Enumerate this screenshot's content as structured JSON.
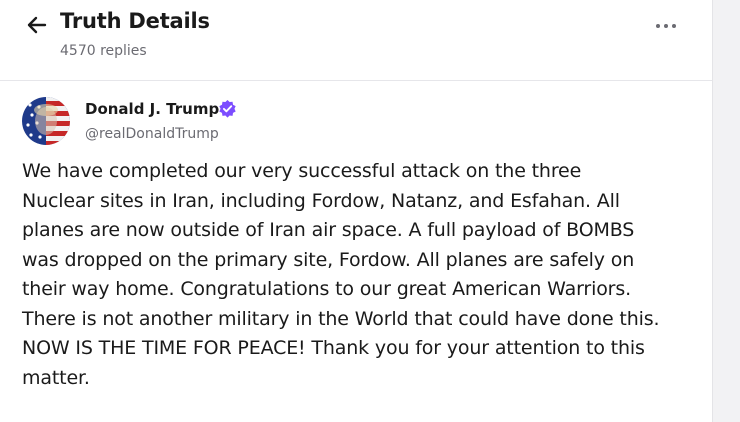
{
  "header": {
    "title": "Truth Details",
    "replies": "4570 replies"
  },
  "author": {
    "display_name": "Donald J. Trump",
    "handle": "@realDonaldTrump",
    "verified": true
  },
  "post": {
    "lines": [
      "We have completed our very successful attack on the three",
      "Nuclear sites in Iran, including Fordow, Natanz, and Esfahan. All",
      "planes are now outside of Iran air space. A full payload of BOMBS",
      "was dropped on the primary site, Fordow. All planes are safely on",
      "their way home. Congratulations to our great American Warriors.",
      "There is not another military in the World that could have done this.",
      "NOW IS THE TIME FOR PEACE! Thank you for your attention to this",
      "matter."
    ]
  },
  "icons": {
    "back": "arrow-left-icon",
    "more": "more-horizontal-icon",
    "verified": "verified-badge-icon"
  },
  "colors": {
    "text": "#1a1a1a",
    "muted": "#6b6b72",
    "verified": "#7c4dff",
    "background": "#ffffff"
  }
}
